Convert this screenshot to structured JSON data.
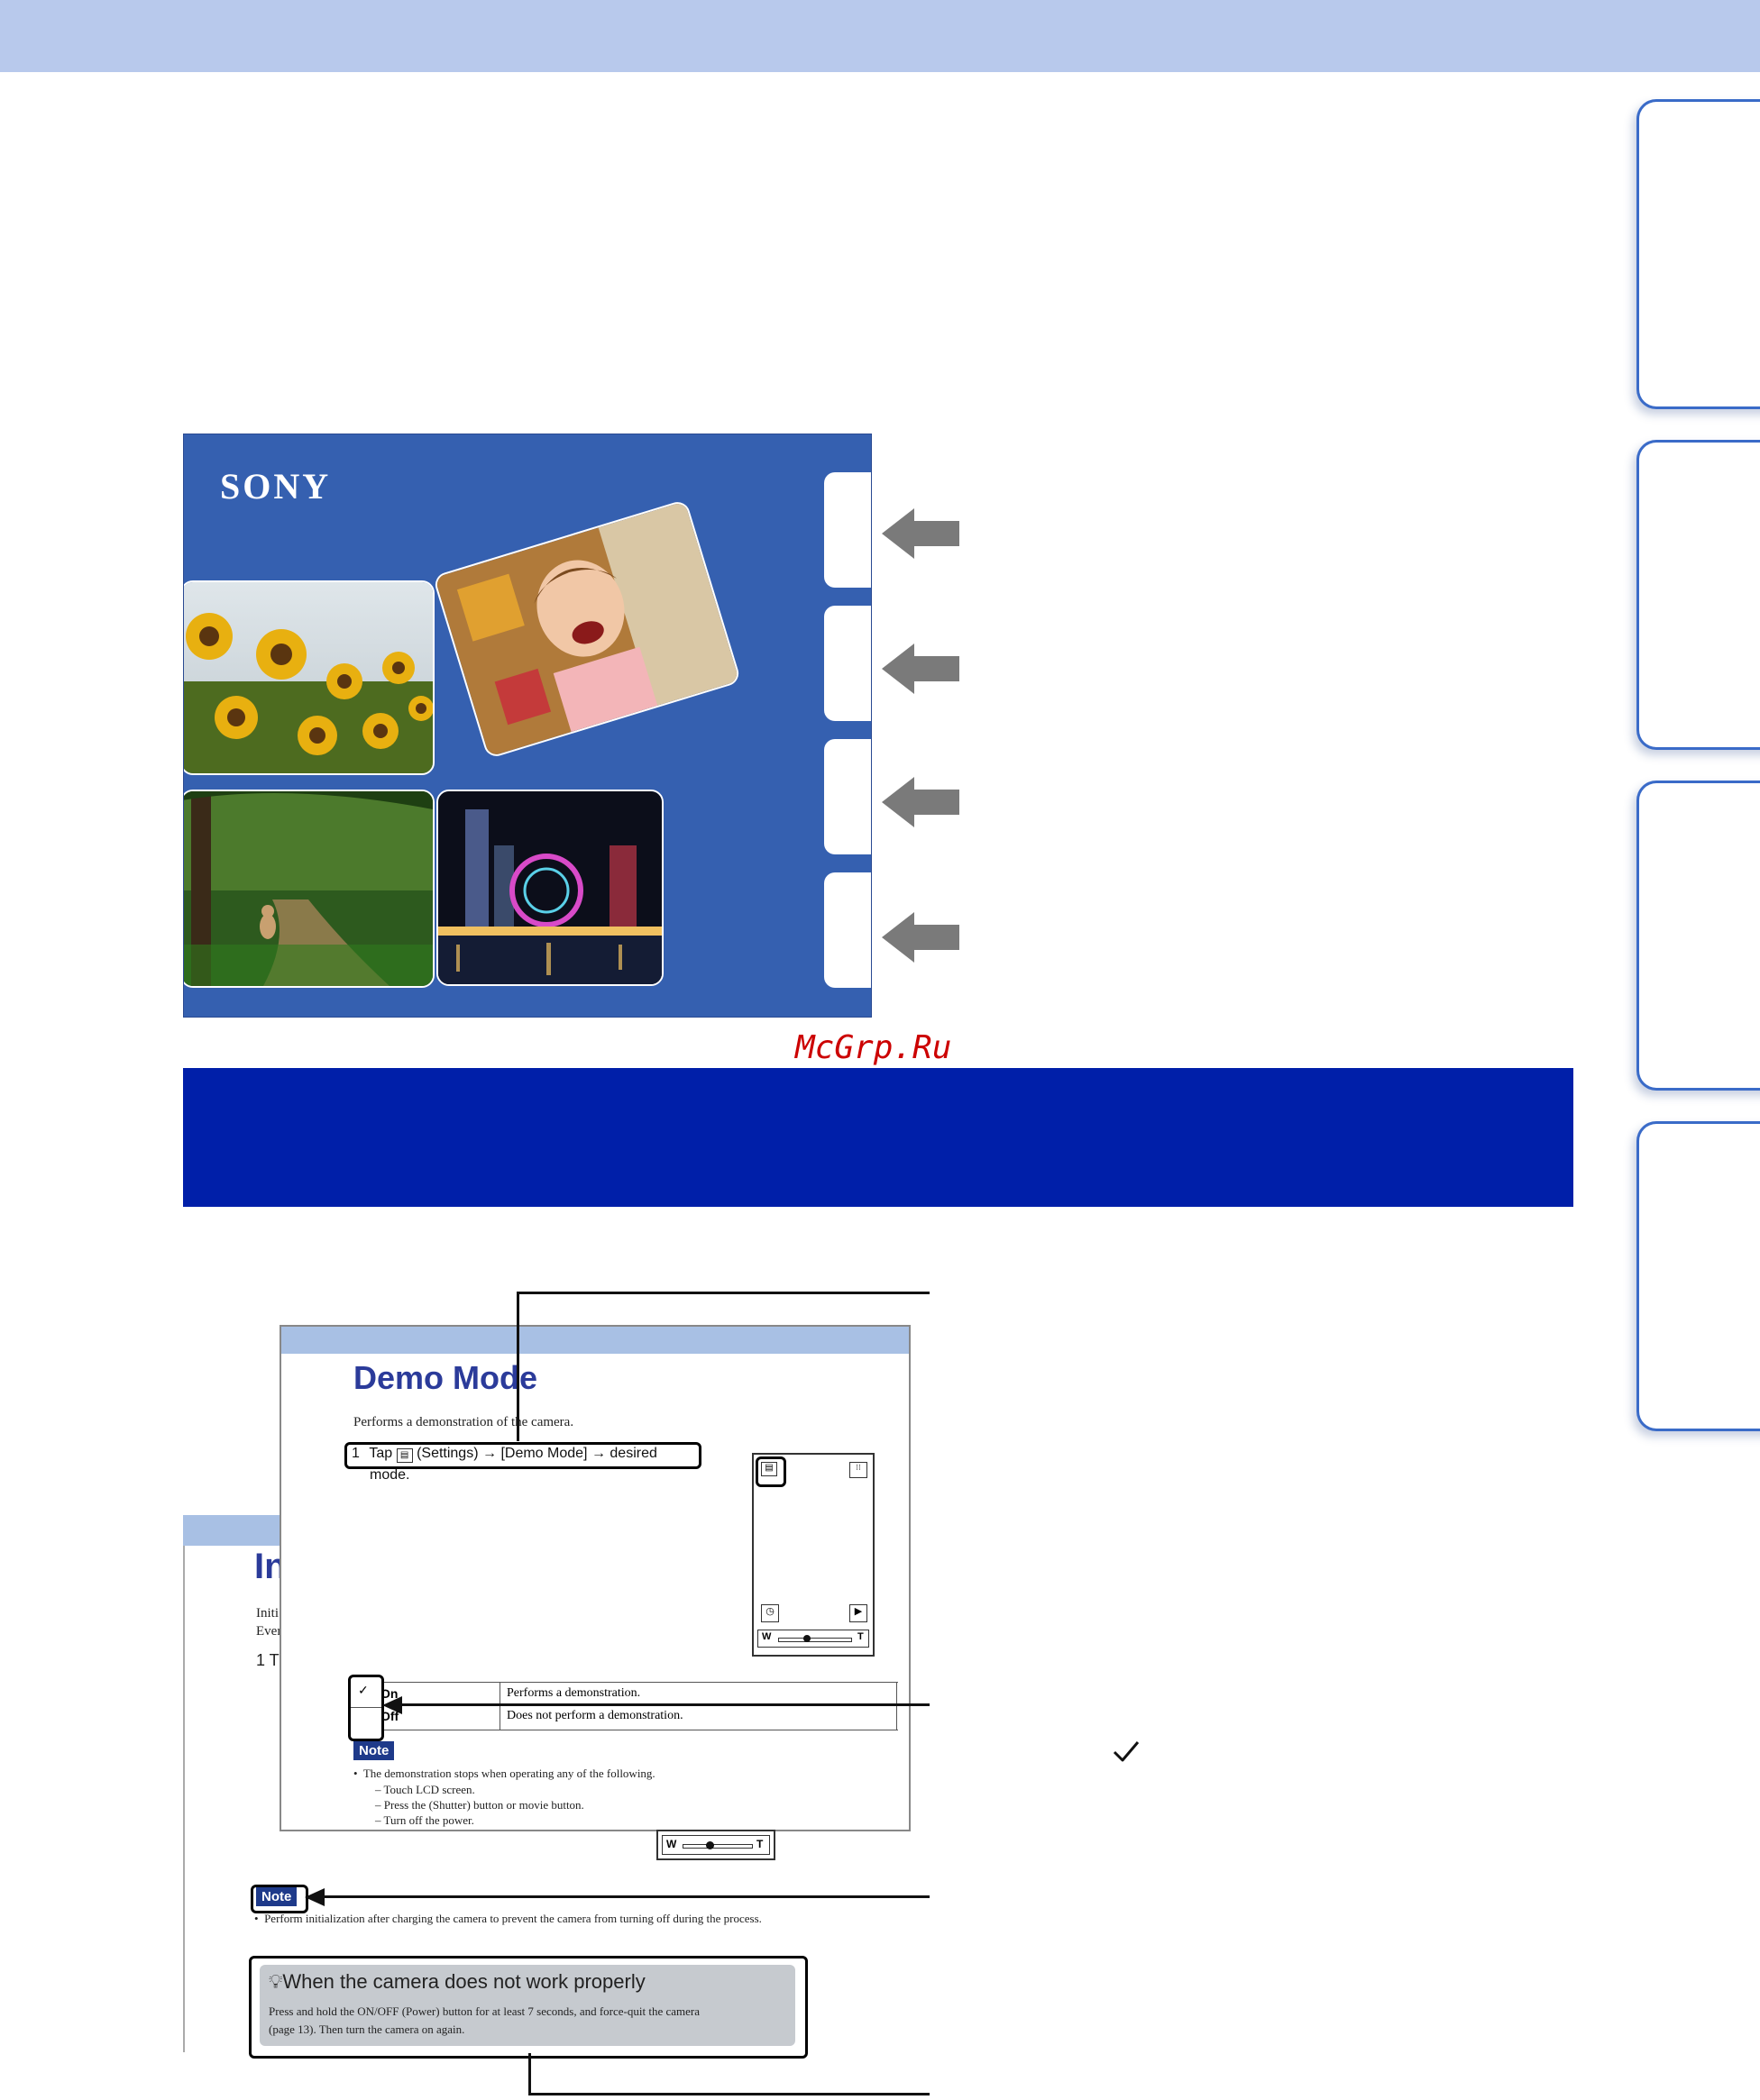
{
  "watermark": "McGrp.Ru",
  "cover": {
    "brand": "SONY"
  },
  "sample_page": {
    "title": "Demo Mode",
    "title_fragment": "In",
    "description": "Performs a demonstration of the camera.",
    "step_number": "1",
    "step_text_before": "Tap",
    "step_settings": "(Settings)",
    "step_arrow": "→",
    "step_demo": "[Demo Mode]",
    "step_desired": "desired",
    "step_cont": "mode.",
    "back_lines": [
      "Initi",
      "Ever",
      "1  T"
    ],
    "table": [
      {
        "option": "On",
        "desc": "Performs a demonstration."
      },
      {
        "option": "Off",
        "desc": "Does not perform a demonstration."
      }
    ],
    "note_label": "Note",
    "note_intro": "The demonstration stops when operating any of the following.",
    "note_items": [
      "Touch LCD screen.",
      "Press the (Shutter) button or movie button.",
      "Turn off the power."
    ],
    "zoom_w": "W",
    "zoom_t": "T",
    "note2_label": "Note",
    "note2_text": "Perform initialization after charging the camera to prevent the camera from turning off during the process.",
    "tip_title": "When the camera does not work properly",
    "tip_text_1": "Press and hold the ON/OFF (Power) button for at least 7 seconds, and force-quit the camera",
    "tip_text_2": "(page 13). Then turn the camera on again."
  },
  "colors": {
    "top_band": "#b8c9ec",
    "blue_bar": "#001fa9",
    "cover_bg": "#3560b0",
    "tab_border": "#3a6bc8",
    "watermark": "#cc0000"
  }
}
